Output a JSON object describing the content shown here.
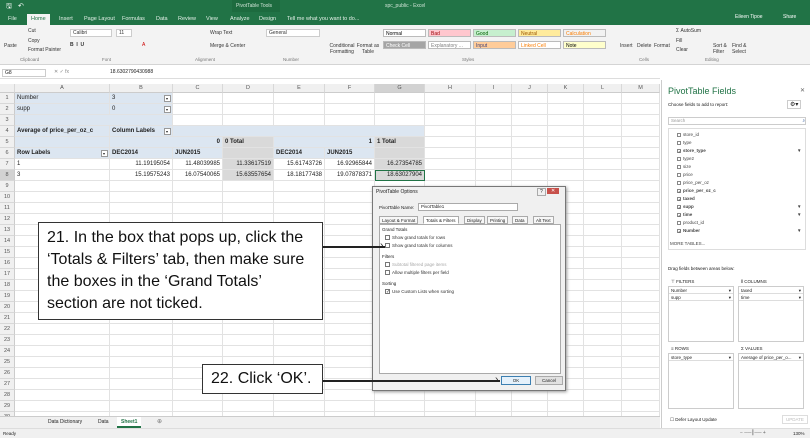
{
  "window": {
    "context_title": "PivotTable Tools",
    "file_title": "spc_public - Excel",
    "user": "Eileen Tipoe",
    "share": "Share"
  },
  "ribbon_tabs": [
    "File",
    "Home",
    "Insert",
    "Page Layout",
    "Formulas",
    "Data",
    "Review",
    "View",
    "Analyze",
    "Design"
  ],
  "tell_me": "Tell me what you want to do...",
  "clipboard": {
    "paste": "Paste",
    "cut": "Cut",
    "copy": "Copy",
    "format_painter": "Format Painter",
    "label": "Clipboard"
  },
  "font": {
    "name": "Calibri",
    "size": "11",
    "label": "Font"
  },
  "alignment": {
    "wrap": "Wrap Text",
    "merge": "Merge & Center",
    "label": "Alignment"
  },
  "number": {
    "format": "General",
    "label": "Number"
  },
  "styles": {
    "conditional": "Conditional Formatting",
    "format_table": "Format as Table",
    "label": "Styles",
    "cells": [
      {
        "t": "Normal",
        "bg": "#ffffff",
        "c": "#000"
      },
      {
        "t": "Bad",
        "bg": "#ffc7ce",
        "c": "#9c0006"
      },
      {
        "t": "Good",
        "bg": "#c6efce",
        "c": "#006100"
      },
      {
        "t": "Neutral",
        "bg": "#ffeb9c",
        "c": "#9c5700"
      },
      {
        "t": "Calculation",
        "bg": "#f2f2f2",
        "c": "#fa7d00"
      },
      {
        "t": "Check Cell",
        "bg": "#a5a5a5",
        "c": "#fff"
      },
      {
        "t": "Explanatory ...",
        "bg": "#ffffff",
        "c": "#7f7f7f"
      },
      {
        "t": "Input",
        "bg": "#ffcc99",
        "c": "#3f3f76"
      },
      {
        "t": "Linked Cell",
        "bg": "#ffffff",
        "c": "#fa7d00"
      },
      {
        "t": "Note",
        "bg": "#ffffcc",
        "c": "#000"
      }
    ]
  },
  "cells_group": {
    "insert": "Insert",
    "delete": "Delete",
    "format": "Format",
    "label": "Cells"
  },
  "editing": {
    "autosum": "AutoSum",
    "fill": "Fill",
    "clear": "Clear",
    "sort": "Sort & Filter",
    "find": "Find & Select",
    "label": "Editing"
  },
  "formula_bar": {
    "name_box": "G8",
    "value": "18.6302790430988"
  },
  "columns": [
    "A",
    "B",
    "C",
    "D",
    "E",
    "F",
    "G",
    "H",
    "I",
    "J",
    "K",
    "L",
    "M"
  ],
  "sheet": {
    "r1": [
      "Number",
      "3"
    ],
    "r2": [
      "supp",
      "0"
    ],
    "r4": [
      "Average of price_per_oz_c",
      "Column Labels"
    ],
    "r5": [
      "0",
      "0 Total",
      "1",
      "1 Total"
    ],
    "r6": [
      "Row Labels",
      "DEC2014",
      "JUN2015",
      "DEC2014",
      "JUN2015"
    ],
    "r7": [
      "1",
      "11.19195054",
      "11.48039985",
      "11.33617519",
      "15.61743726",
      "16.92965844",
      "16.27354785"
    ],
    "r8": [
      "3",
      "15.19575243",
      "16.07540065",
      "15.63557654",
      "18.18177438",
      "19.07878371",
      "18.63027904"
    ]
  },
  "sheet_tabs": [
    "Data Dictionary",
    "Data",
    "Sheet1"
  ],
  "status": "Ready",
  "zoom": "130%",
  "panel": {
    "title": "PivotTable Fields",
    "subtitle": "Choose fields to add to report:",
    "search_placeholder": "Search",
    "fields": [
      {
        "n": "store_id",
        "c": false
      },
      {
        "n": "type",
        "c": false
      },
      {
        "n": "store_type",
        "c": true,
        "f": true
      },
      {
        "n": "type2",
        "c": false
      },
      {
        "n": "size",
        "c": false
      },
      {
        "n": "price",
        "c": false
      },
      {
        "n": "price_per_oz",
        "c": false
      },
      {
        "n": "price_per_oz_c",
        "c": true
      },
      {
        "n": "taxed",
        "c": true
      },
      {
        "n": "supp",
        "c": true,
        "f": true
      },
      {
        "n": "time",
        "c": true,
        "f": true
      },
      {
        "n": "product_id",
        "c": false
      },
      {
        "n": "Number",
        "c": true,
        "f": true
      }
    ],
    "more": "MORE TABLES...",
    "drag": "Drag fields between areas below:",
    "filters": {
      "label": "FILTERS",
      "items": [
        "Number",
        "supp"
      ]
    },
    "columns": {
      "label": "COLUMNS",
      "items": [
        "taxed",
        "time"
      ]
    },
    "rows": {
      "label": "ROWS",
      "items": [
        "store_type"
      ]
    },
    "values": {
      "label": "VALUES",
      "items": [
        "Average of price_per_o..."
      ]
    },
    "defer": "Defer Layout Update",
    "update": "UPDATE"
  },
  "dialog": {
    "title": "PivotTable Options",
    "name_label": "PivotTable Name:",
    "name_value": "PivotTable1",
    "tabs": [
      "Layout & Format",
      "Totals & Filters",
      "Display",
      "Printing",
      "Data",
      "Alt Text"
    ],
    "grand_totals": "Grand Totals",
    "rows_opt": "Show grand totals for rows",
    "cols_opt": "Show grand totals for columns",
    "filters": "Filters",
    "subtotal": "Subtotal filtered page items",
    "multiple": "Allow multiple filters per field",
    "sorting": "Sorting",
    "custom": "Use Custom Lists when sorting",
    "ok": "OK",
    "cancel": "Cancel"
  },
  "callouts": {
    "step21": "21. In the box that pops up, click the ‘Totals & Filters’ tab, then make sure the boxes in the ‘Grand Totals’ section are not ticked.",
    "step22": "22. Click ‘OK’."
  }
}
